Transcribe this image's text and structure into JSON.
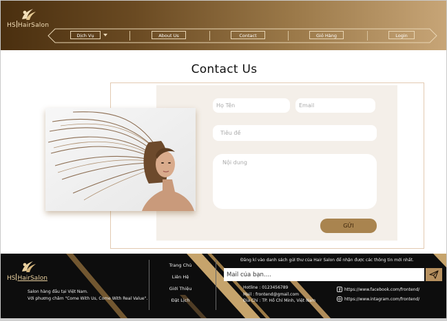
{
  "brand": {
    "hs": "HS",
    "name": "HairSalon"
  },
  "nav": {
    "items": [
      {
        "label": "Dịch Vụ"
      },
      {
        "label": "About Us"
      },
      {
        "label": "Contact"
      },
      {
        "label": "Giỏ Hàng"
      },
      {
        "label": "Login"
      }
    ]
  },
  "page": {
    "title": "Contact Us"
  },
  "form": {
    "name_placeholder": "Họ Tên",
    "email_placeholder": "Email",
    "subject_placeholder": "Tiêu đề",
    "message_placeholder": "Nội dung",
    "submit_label": "GỬI"
  },
  "footer": {
    "desc_line1": "Salon hàng đầu tại Việt Nam.",
    "desc_line2": "Với phương châm \"Come With Us, Come With Real Value\".",
    "links": [
      "Trang Chủ",
      "Liên Hệ",
      "Giới Thiệu",
      "Đặt Lịch"
    ],
    "newsletter_text": "Đăng kí vào danh sách gửi thư của Hair Salon để nhận được các thông tin mới nhất.",
    "newsletter_placeholder": "Mail của bạn....",
    "hotline": "Hotline : 0123456789",
    "mail": "Mail : frontend@gmail.com",
    "address": "Địa Chỉ : TP. Hồ Chí Minh, Việt Nam",
    "facebook": "https://www.facebook.com/frontend/",
    "instagram": "https://www.intagram.com/frontend/"
  },
  "colors": {
    "accent": "#a9844f",
    "header_dark": "#4a2f0f",
    "header_light": "#c7a577",
    "footer_bg": "#0d0d0d"
  }
}
